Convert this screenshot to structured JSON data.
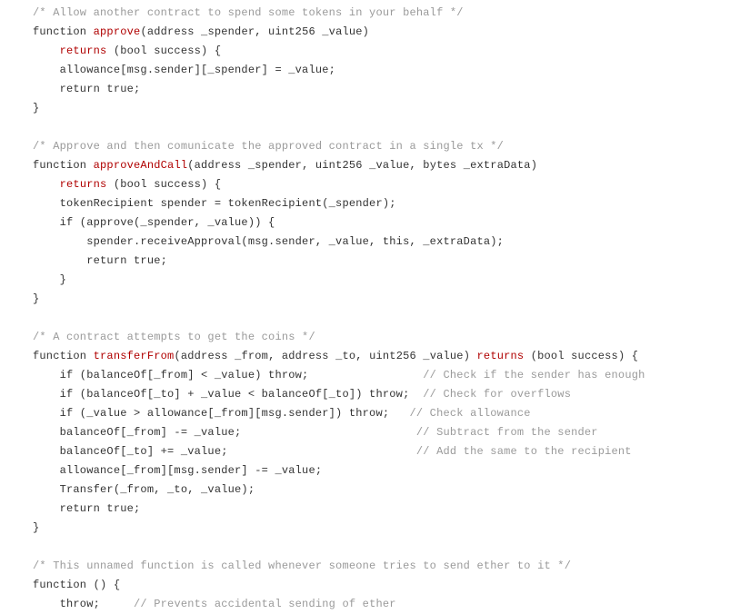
{
  "lines": [
    {
      "segs": [
        {
          "t": "/* Allow another contract to spend some tokens in your behalf */",
          "c": "cm"
        }
      ]
    },
    {
      "segs": [
        {
          "t": "function "
        },
        {
          "t": "approve",
          "c": "kw"
        },
        {
          "t": "(address _spender, uint256 _value)"
        }
      ]
    },
    {
      "segs": [
        {
          "t": "    "
        },
        {
          "t": "returns",
          "c": "kw"
        },
        {
          "t": " (bool success) {"
        }
      ]
    },
    {
      "segs": [
        {
          "t": "    allowance[msg.sender][_spender] = _value;"
        }
      ]
    },
    {
      "segs": [
        {
          "t": "    return true;"
        }
      ]
    },
    {
      "segs": [
        {
          "t": "}"
        }
      ]
    },
    {
      "segs": [
        {
          "t": ""
        }
      ]
    },
    {
      "segs": [
        {
          "t": "/* Approve and then comunicate the approved contract in a single tx */",
          "c": "cm"
        }
      ]
    },
    {
      "segs": [
        {
          "t": "function "
        },
        {
          "t": "approveAndCall",
          "c": "kw"
        },
        {
          "t": "(address _spender, uint256 _value, bytes _extraData)"
        }
      ]
    },
    {
      "segs": [
        {
          "t": "    "
        },
        {
          "t": "returns",
          "c": "kw"
        },
        {
          "t": " (bool success) {"
        }
      ]
    },
    {
      "segs": [
        {
          "t": "    tokenRecipient spender = tokenRecipient(_spender);"
        }
      ]
    },
    {
      "segs": [
        {
          "t": "    if (approve(_spender, _value)) {"
        }
      ]
    },
    {
      "segs": [
        {
          "t": "        spender.receiveApproval(msg.sender, _value, this, _extraData);"
        }
      ]
    },
    {
      "segs": [
        {
          "t": "        return true;"
        }
      ]
    },
    {
      "segs": [
        {
          "t": "    }"
        }
      ]
    },
    {
      "segs": [
        {
          "t": "}"
        }
      ]
    },
    {
      "segs": [
        {
          "t": ""
        }
      ]
    },
    {
      "segs": [
        {
          "t": "/* A contract attempts to get the coins */",
          "c": "cm"
        }
      ]
    },
    {
      "segs": [
        {
          "t": "function "
        },
        {
          "t": "transferFrom",
          "c": "kw"
        },
        {
          "t": "(address _from, address _to, uint256 _value) "
        },
        {
          "t": "returns",
          "c": "kw"
        },
        {
          "t": " (bool success) {"
        }
      ]
    },
    {
      "segs": [
        {
          "t": "    if (balanceOf[_from] < _value) throw;                 "
        },
        {
          "t": "// Check if the sender has enough",
          "c": "cm"
        }
      ]
    },
    {
      "segs": [
        {
          "t": "    if (balanceOf[_to] + _value < balanceOf[_to]) throw;  "
        },
        {
          "t": "// Check for overflows",
          "c": "cm"
        }
      ]
    },
    {
      "segs": [
        {
          "t": "    if (_value > allowance[_from][msg.sender]) throw;   "
        },
        {
          "t": "// Check allowance",
          "c": "cm"
        }
      ]
    },
    {
      "segs": [
        {
          "t": "    balanceOf[_from] -= _value;                          "
        },
        {
          "t": "// Subtract from the sender",
          "c": "cm"
        }
      ]
    },
    {
      "segs": [
        {
          "t": "    balanceOf[_to] += _value;                            "
        },
        {
          "t": "// Add the same to the recipient",
          "c": "cm"
        }
      ]
    },
    {
      "segs": [
        {
          "t": "    allowance[_from][msg.sender] -= _value;"
        }
      ]
    },
    {
      "segs": [
        {
          "t": "    Transfer(_from, _to, _value);"
        }
      ]
    },
    {
      "segs": [
        {
          "t": "    return true;"
        }
      ]
    },
    {
      "segs": [
        {
          "t": "}"
        }
      ]
    },
    {
      "segs": [
        {
          "t": ""
        }
      ]
    },
    {
      "segs": [
        {
          "t": "/* This unnamed function is called whenever someone tries to send ether to it */",
          "c": "cm"
        }
      ]
    },
    {
      "segs": [
        {
          "t": "function () {"
        }
      ]
    },
    {
      "segs": [
        {
          "t": "    throw;     "
        },
        {
          "t": "// Prevents accidental sending of ether",
          "c": "cm"
        }
      ]
    }
  ]
}
